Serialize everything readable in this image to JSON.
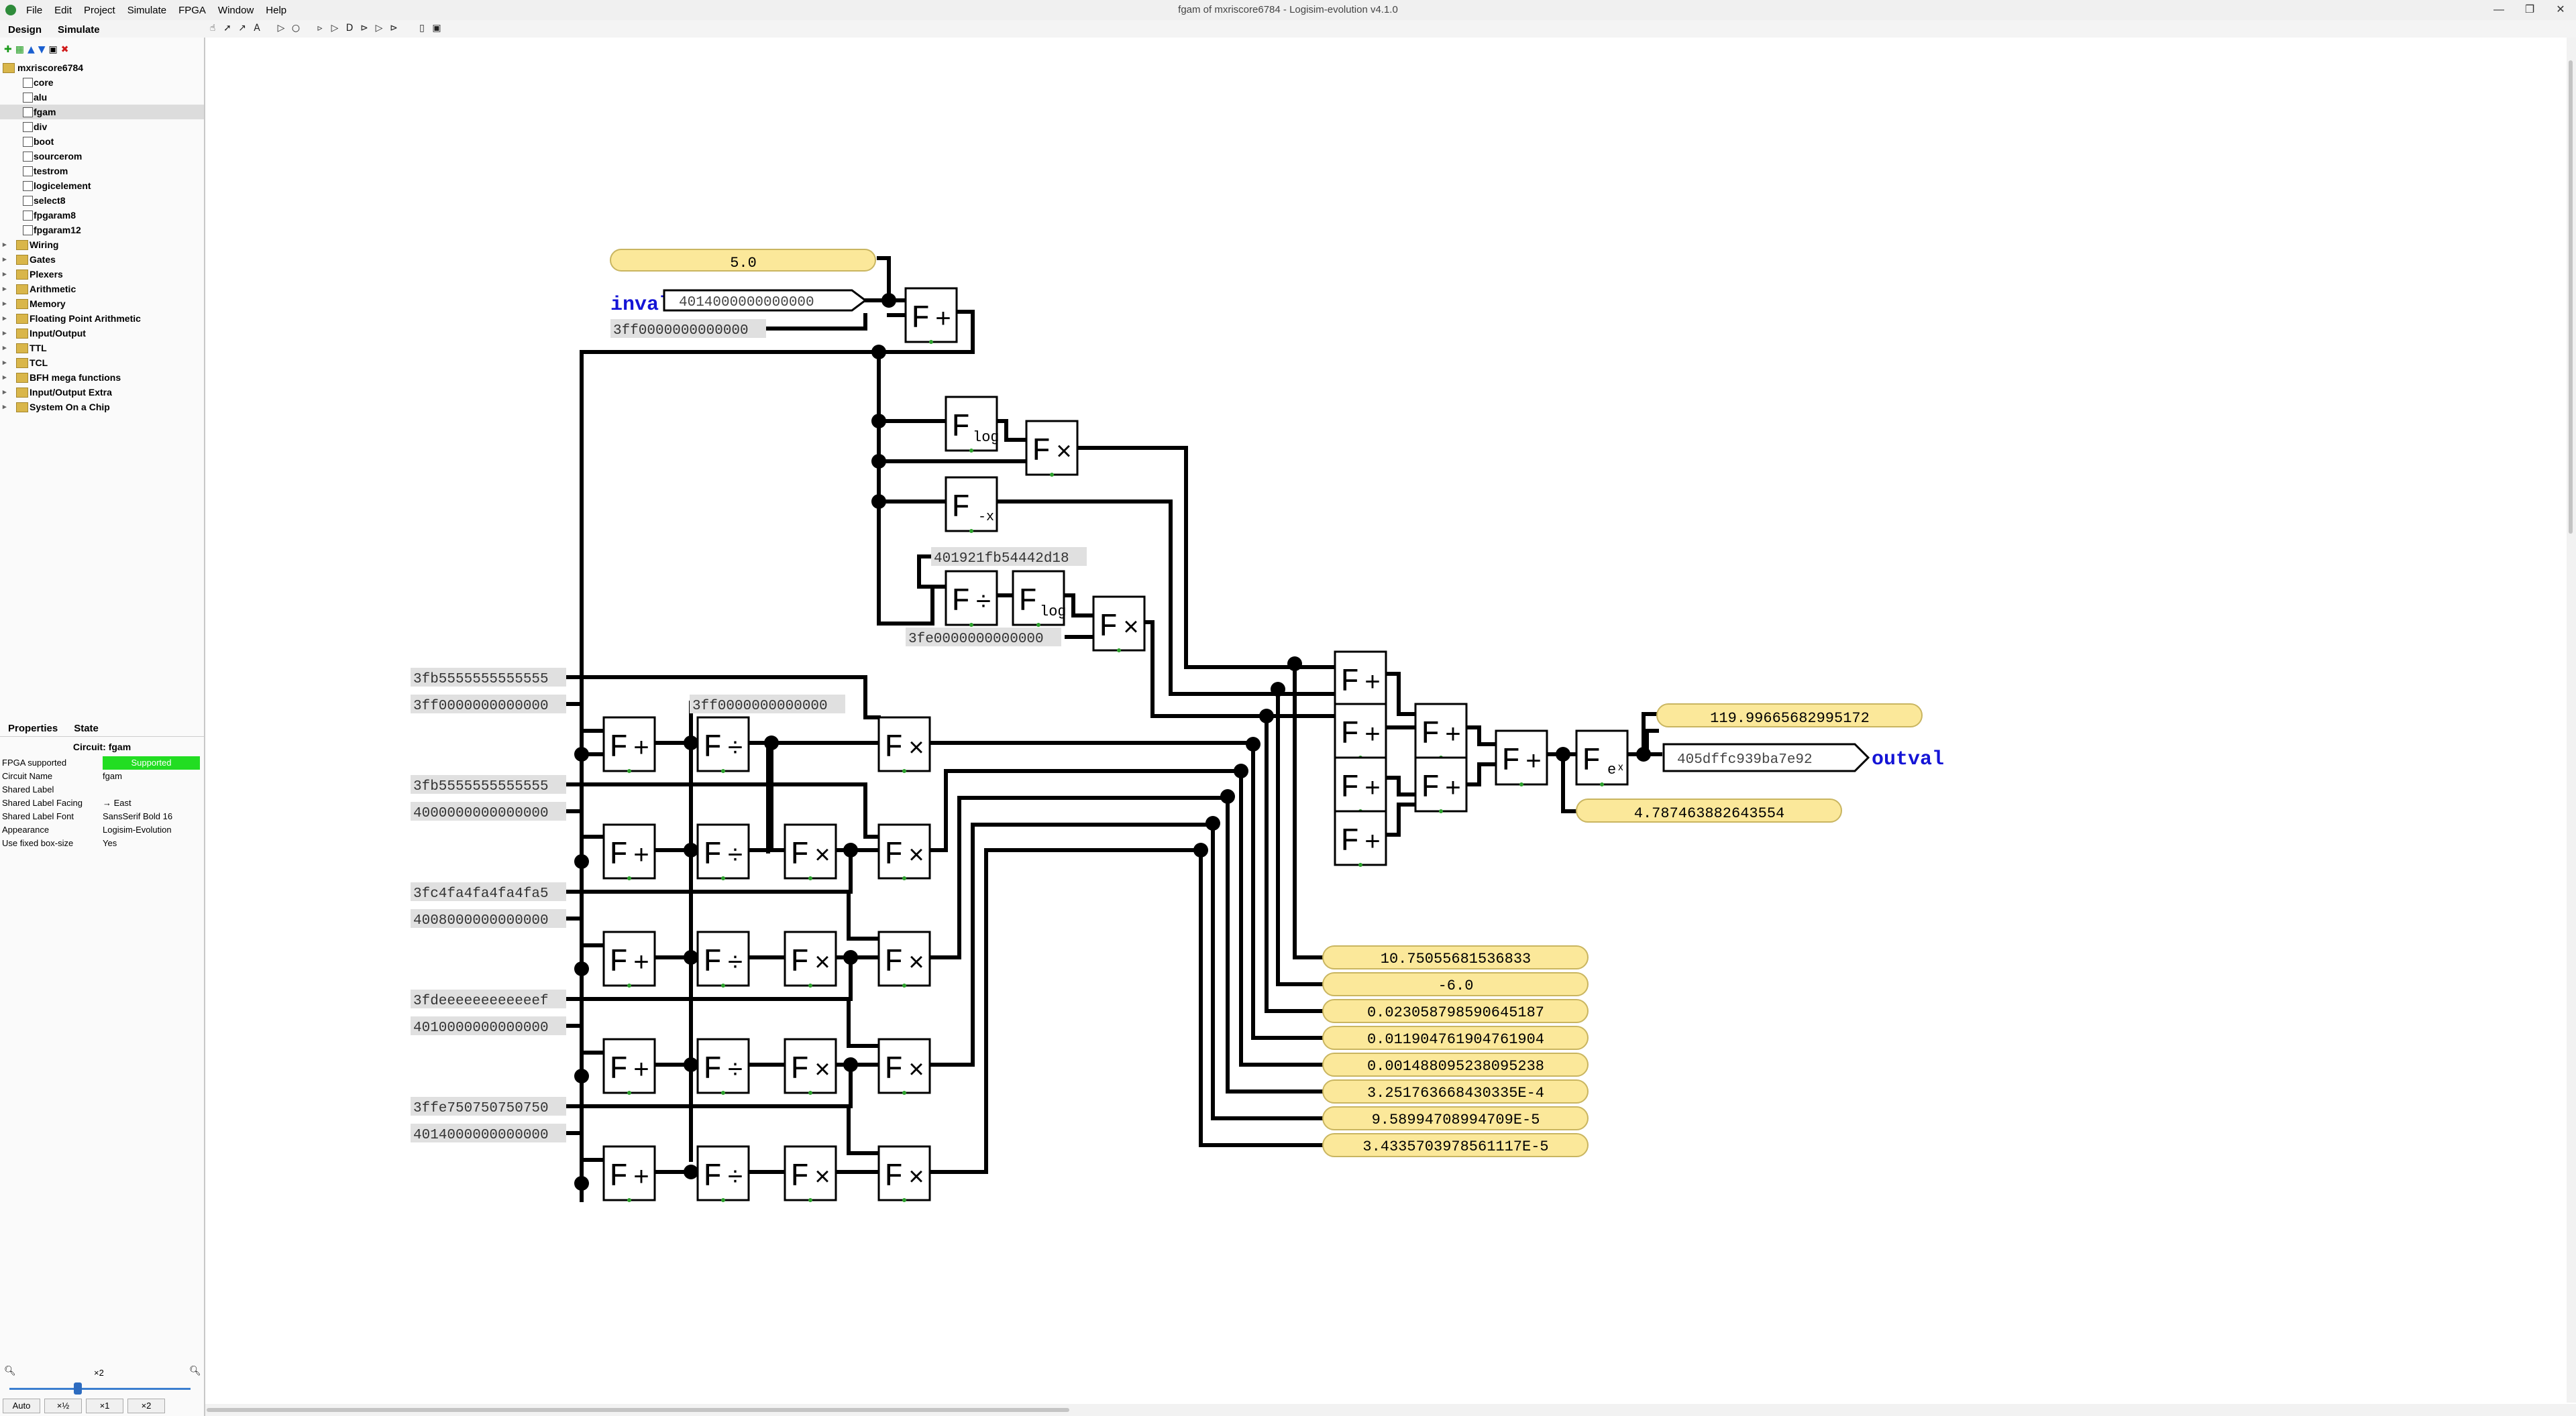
{
  "window": {
    "title": "fgam of mxriscore6784 - Logisim-evolution v4.1.0",
    "controls": [
      "—",
      "❐",
      "✕"
    ]
  },
  "menu": [
    "File",
    "Edit",
    "Project",
    "Simulate",
    "FPGA",
    "Window",
    "Help"
  ],
  "tabs": {
    "design": "Design",
    "simulate": "Simulate"
  },
  "explorer": {
    "root": "mxriscore6784",
    "circuits": [
      "core",
      "alu",
      "fgam",
      "div",
      "boot",
      "sourcerom",
      "testrom",
      "logicelement",
      "select8",
      "fpgaram8",
      "fpgaram12"
    ],
    "selected": "fgam",
    "libraries": [
      "Wiring",
      "Gates",
      "Plexers",
      "Arithmetic",
      "Memory",
      "Floating Point Arithmetic",
      "Input/Output",
      "TTL",
      "TCL",
      "BFH mega functions",
      "Input/Output Extra",
      "System On a Chip"
    ]
  },
  "properties": {
    "tabs": {
      "properties": "Properties",
      "state": "State"
    },
    "title": "Circuit: fgam",
    "rows": [
      {
        "key": "FPGA supported",
        "value": "Supported"
      },
      {
        "key": "Circuit Name",
        "value": "fgam"
      },
      {
        "key": "Shared Label",
        "value": ""
      },
      {
        "key": "Shared Label Facing",
        "value": "→ East"
      },
      {
        "key": "Shared Label Font",
        "value": "SansSerif Bold 16"
      },
      {
        "key": "Appearance",
        "value": "Logisim-Evolution"
      },
      {
        "key": "Use fixed box-size",
        "value": "Yes"
      }
    ]
  },
  "zoom": {
    "label": "×2",
    "buttons": [
      "Auto",
      "×½",
      "×1",
      "×2"
    ]
  },
  "circuit": {
    "top_probe": "5.0",
    "inval_label": "inval",
    "outval_label": "outval",
    "inval_value": "4014000000000000",
    "outval_value": "405dffc939ba7e92",
    "const_one": "3ff0000000000000",
    "const_pi": "401921fb54442d18",
    "const_half": "3fe0000000000000",
    "const_one_b": "3ff0000000000000",
    "left_constants": [
      "3fb5555555555555",
      "3ff0000000000000",
      "3fb5555555555555",
      "4000000000000000",
      "3fc4fa4fa4fa4fa5",
      "4008000000000000",
      "3fdeeeeeeeeeeeef",
      "4010000000000000",
      "3ffe750750750750",
      "4014000000000000"
    ],
    "result_probe": "119.99665682995172",
    "exp_probe": "4.787463882643554",
    "term_probes": [
      "10.75055681536833",
      "-6.0",
      "0.023058798590645187",
      "0.011904761904761904",
      "0.001488095238095238",
      "3.251763668430335E-4",
      "9.58994708994709E-5",
      "3.4335703978561117E-5"
    ],
    "op_symbols": {
      "add": "+",
      "mul": "×",
      "div": "÷",
      "log": "log",
      "neg": "-x",
      "exp": "eˣ",
      "F": "F"
    }
  }
}
